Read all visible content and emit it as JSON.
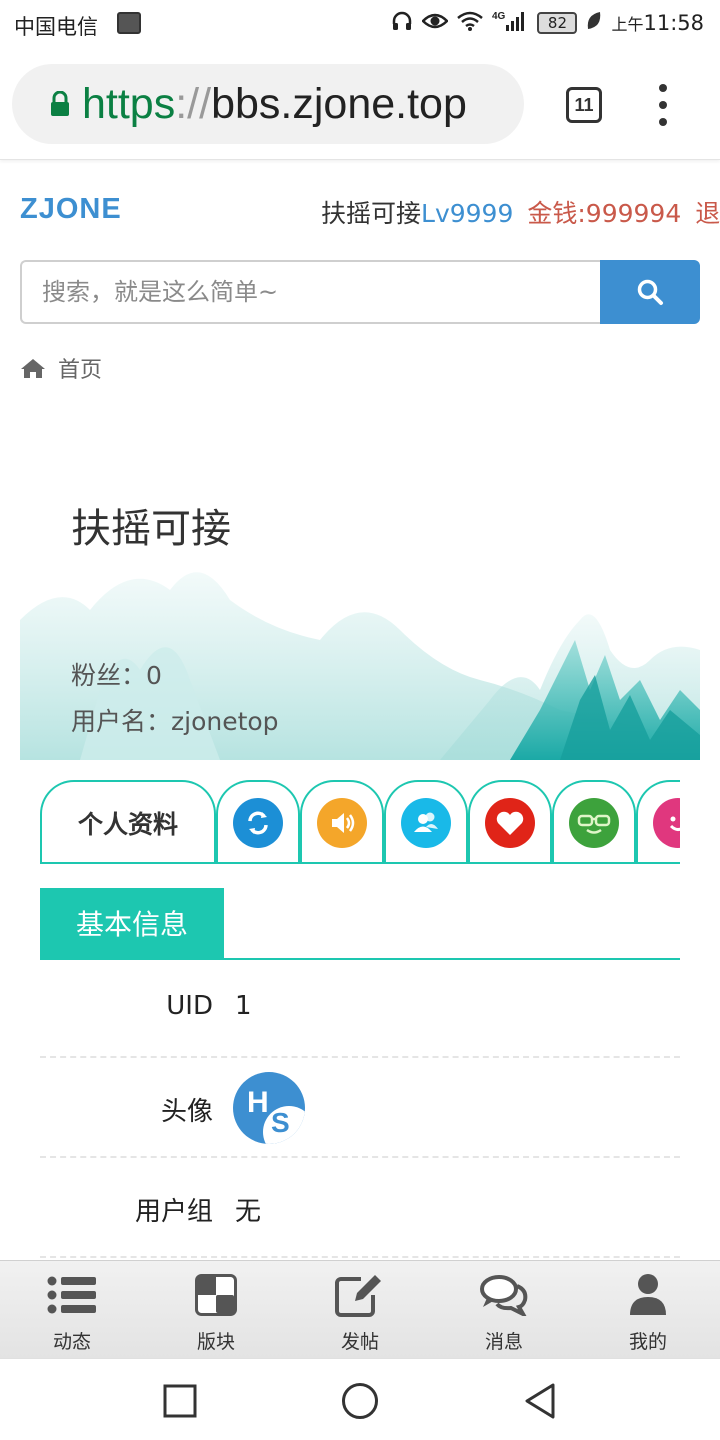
{
  "status_bar": {
    "carrier": "中国电信",
    "network": "4G",
    "battery": "82",
    "time_prefix": "上午",
    "time": "11:58"
  },
  "browser": {
    "url_scheme": "https",
    "url_separator": "://",
    "url_host": "bbs.zjone.top",
    "tab_count": "11"
  },
  "header": {
    "logo": "ZJONE",
    "user_name": "扶摇可接",
    "user_level": "Lv9999",
    "user_money": "金钱:999994",
    "user_more": "退"
  },
  "search": {
    "placeholder": "搜索，就是这么简单~"
  },
  "breadcrumb": {
    "home": "首页"
  },
  "profile": {
    "name": "扶摇可接",
    "fans": "粉丝：0",
    "username": "用户名：zjonetop"
  },
  "tabs": {
    "active_label": "个人资料",
    "icons": [
      "refresh-icon",
      "speaker-icon",
      "friends-icon",
      "heart-icon",
      "glasses-face-icon",
      "smile-icon"
    ],
    "colors": [
      "#1c8fd6",
      "#f4a62a",
      "#19b9e8",
      "#e02418",
      "#3da23c",
      "#e0377e"
    ]
  },
  "section": {
    "title": "基本信息"
  },
  "info": [
    {
      "label": "UID",
      "value": "1"
    },
    {
      "label": "头像",
      "avatar_text_h": "H",
      "avatar_text_s": "S"
    },
    {
      "label": "用户组",
      "value": "无"
    }
  ],
  "bottom_nav": [
    {
      "label": "动态",
      "icon": "list-icon"
    },
    {
      "label": "版块",
      "icon": "grid-icon"
    },
    {
      "label": "发帖",
      "icon": "edit-icon"
    },
    {
      "label": "消息",
      "icon": "chat-icon"
    },
    {
      "label": "我的",
      "icon": "user-icon"
    }
  ],
  "colors": {
    "accent_blue": "#3d8fd1",
    "accent_teal": "#1dc7b0",
    "money_red": "#c9594a",
    "url_green": "#0b8043"
  }
}
